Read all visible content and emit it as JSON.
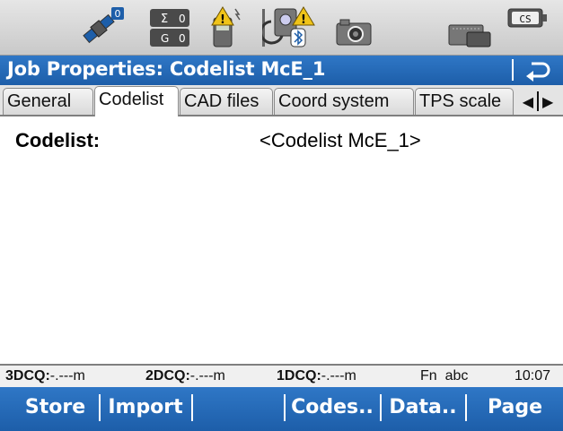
{
  "status_icons": {
    "satellite_count": "0",
    "sigma_value": "0",
    "g_value": "0",
    "battery_label": "CS"
  },
  "title_bar": {
    "title": "Job Properties: Codelist McE_1"
  },
  "tabs": [
    {
      "label": "General",
      "active": false
    },
    {
      "label": "Codelist",
      "active": true
    },
    {
      "label": "CAD files",
      "active": false
    },
    {
      "label": "Coord system",
      "active": false
    },
    {
      "label": "TPS scale",
      "active": false
    }
  ],
  "tab_nav": {
    "prev": "◀",
    "next": "▶"
  },
  "content": {
    "codelist_label": "Codelist:",
    "codelist_value": "<Codelist McE_1>"
  },
  "status_line": {
    "cq3d_label": "3DCQ:",
    "cq3d_value": "-.---m",
    "cq2d_label": "2DCQ:",
    "cq2d_value": "-.---m",
    "cq1d_label": "1DCQ:",
    "cq1d_value": "-.---m",
    "mode": "Fn  abc",
    "time": "10:07"
  },
  "softkeys": {
    "store": "Store",
    "import": "Import",
    "codes": "Codes..",
    "data": "Data..",
    "page": "Page"
  },
  "colors": {
    "title_bg": "#2a6fbe",
    "softkey_bg": "#2a6fbe",
    "warning_yellow": "#f0c419"
  }
}
